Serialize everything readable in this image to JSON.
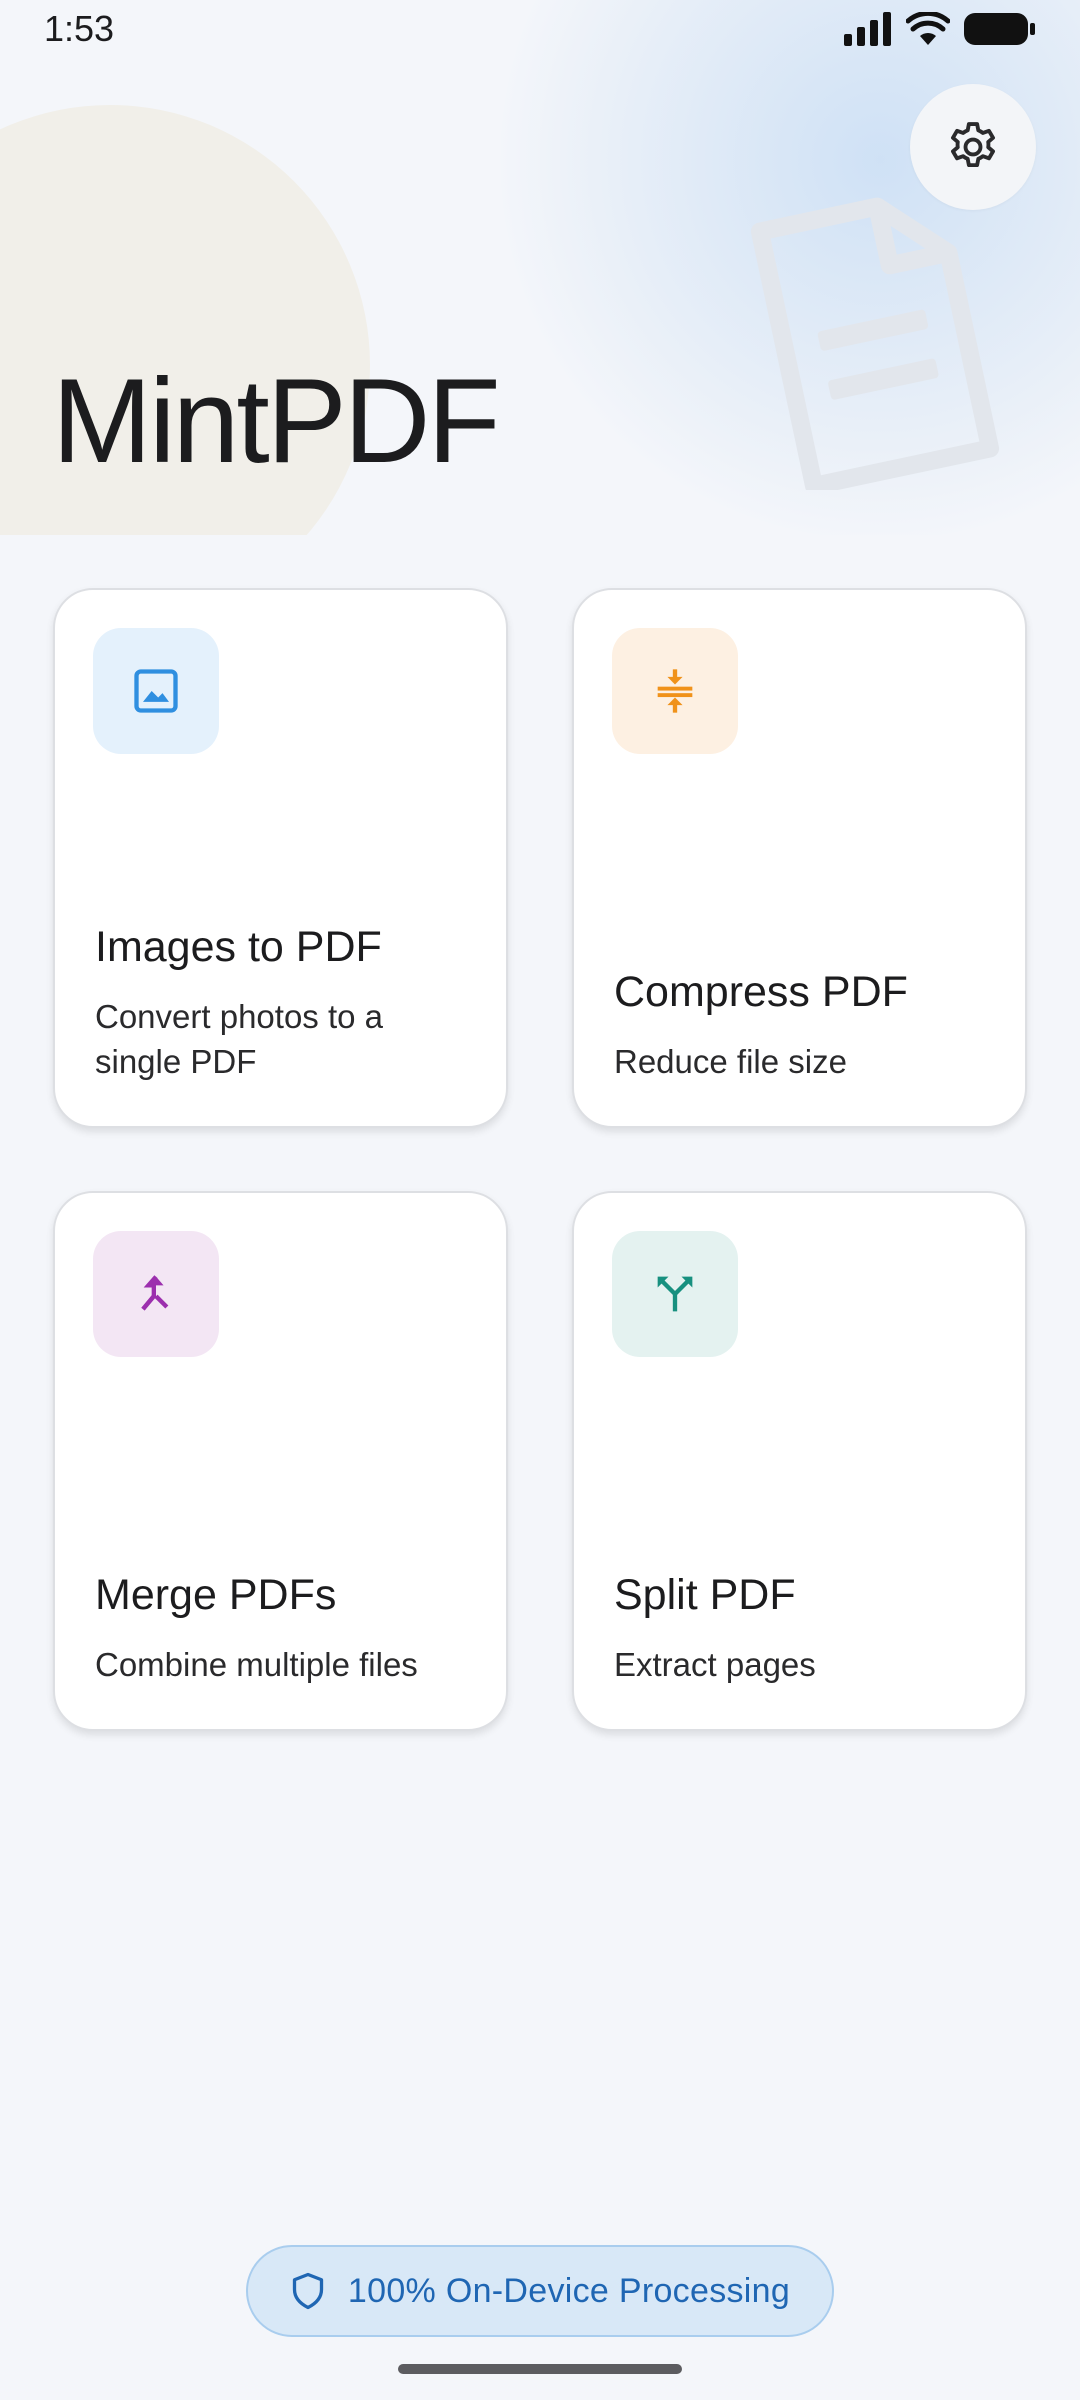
{
  "status_bar": {
    "time": "1:53",
    "icons": [
      "cellular-signal-icon",
      "wifi-icon",
      "battery-icon"
    ]
  },
  "header": {
    "title": "MintPDF",
    "settings_icon": "gear-icon"
  },
  "tools": [
    {
      "title": "Images to PDF",
      "subtitle": "Convert photos to a single PDF",
      "icon": "image-icon",
      "icon_color": "#2f8fe0",
      "tile_color": "#e4f1fc"
    },
    {
      "title": "Compress PDF",
      "subtitle": "Reduce file size",
      "icon": "compress-icon",
      "icon_color": "#f0921a",
      "tile_color": "#fdf0e2"
    },
    {
      "title": "Merge PDFs",
      "subtitle": "Combine multiple files",
      "icon": "merge-icon",
      "icon_color": "#9c2fae",
      "tile_color": "#f3e6f4"
    },
    {
      "title": "Split PDF",
      "subtitle": "Extract pages",
      "icon": "split-icon",
      "icon_color": "#17907f",
      "tile_color": "#e4f2f0"
    }
  ],
  "footer": {
    "privacy_label": "100% On-Device Processing",
    "privacy_icon": "shield-icon",
    "accent": "#1f66b3"
  }
}
